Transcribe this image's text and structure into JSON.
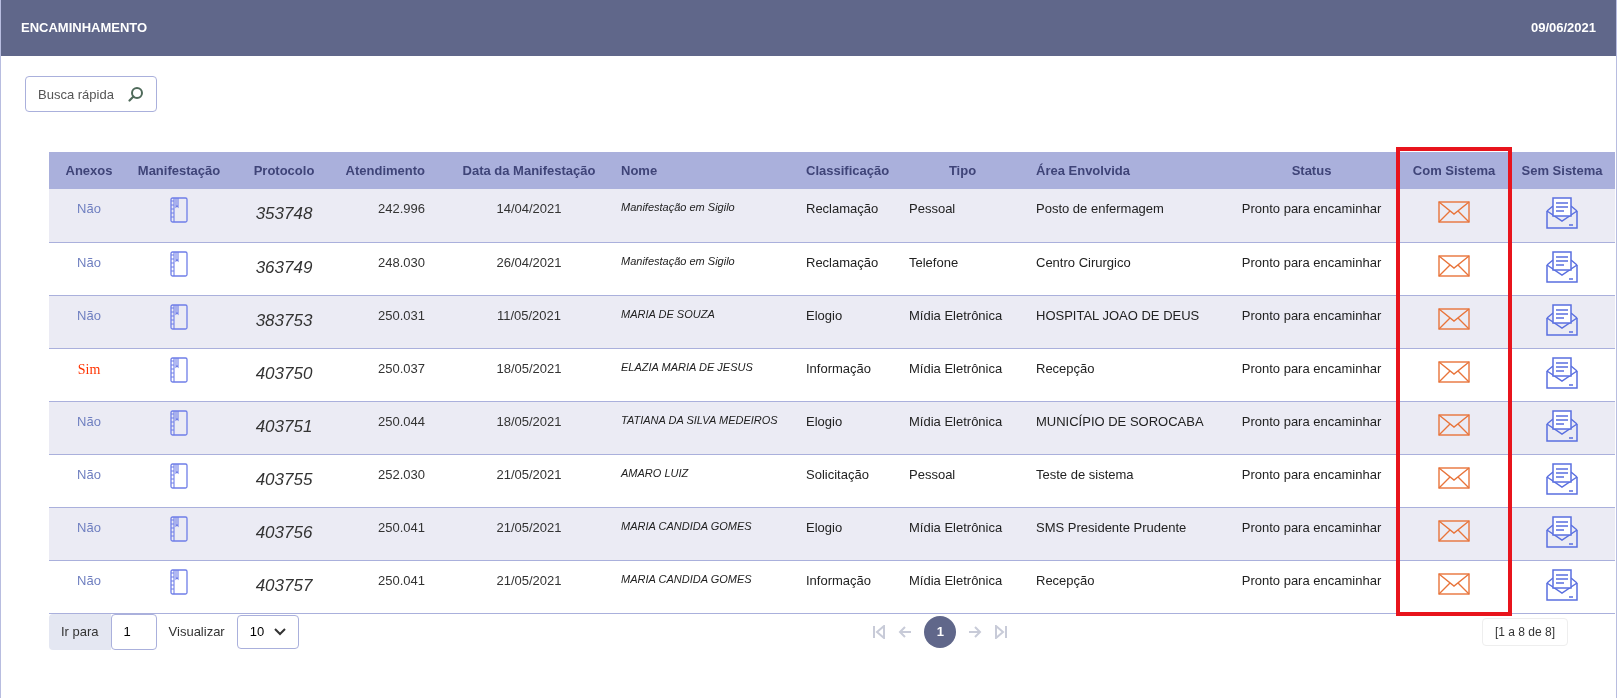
{
  "header": {
    "title": "ENCAMINHAMENTO",
    "date": "09/06/2021"
  },
  "search": {
    "placeholder": "Busca rápida"
  },
  "table": {
    "columns": [
      {
        "label": "Anexos",
        "highlighted": false
      },
      {
        "label": "Manifestação",
        "highlighted": false
      },
      {
        "label": "Protocolo",
        "highlighted": false
      },
      {
        "label": "Atendimento",
        "highlighted": false
      },
      {
        "label": "Data da Manifestação",
        "highlighted": false
      },
      {
        "label": "Nome",
        "highlighted": false
      },
      {
        "label": "Classificação",
        "highlighted": false
      },
      {
        "label": "Tipo",
        "highlighted": false
      },
      {
        "label": "Área Envolvida",
        "highlighted": false
      },
      {
        "label": "Status",
        "highlighted": false
      },
      {
        "label": "Com Sistema",
        "highlighted": true
      },
      {
        "label": "Sem Sistema",
        "highlighted": false
      }
    ],
    "rows": [
      {
        "anexos": "Não",
        "has_attachment": false,
        "protocolo": "353748",
        "atendimento": "242.996",
        "data": "14/04/2021",
        "nome": "Manifestação em Sigilo",
        "classificacao": "Reclamação",
        "tipo": "Pessoal",
        "area": "Posto de enfermagem",
        "status": "Pronto para encaminhar"
      },
      {
        "anexos": "Não",
        "has_attachment": false,
        "protocolo": "363749",
        "atendimento": "248.030",
        "data": "26/04/2021",
        "nome": "Manifestação em Sigilo",
        "classificacao": "Reclamação",
        "tipo": "Telefone",
        "area": "Centro Cirurgico",
        "status": "Pronto para encaminhar"
      },
      {
        "anexos": "Não",
        "has_attachment": false,
        "protocolo": "383753",
        "atendimento": "250.031",
        "data": "11/05/2021",
        "nome": "MARIA DE SOUZA",
        "classificacao": "Elogio",
        "tipo": "Mídia Eletrônica",
        "area": "HOSPITAL JOAO DE DEUS",
        "status": "Pronto para encaminhar"
      },
      {
        "anexos": "Sim",
        "has_attachment": true,
        "protocolo": "403750",
        "atendimento": "250.037",
        "data": "18/05/2021",
        "nome": "ELAZIA MARIA DE JESUS",
        "classificacao": "Informação",
        "tipo": "Mídia Eletrônica",
        "area": "Recepção",
        "status": "Pronto para encaminhar"
      },
      {
        "anexos": "Não",
        "has_attachment": false,
        "protocolo": "403751",
        "atendimento": "250.044",
        "data": "18/05/2021",
        "nome": "TATIANA DA SILVA MEDEIROS",
        "classificacao": "Elogio",
        "tipo": "Mídia Eletrônica",
        "area": "MUNICÍPIO DE SOROCABA",
        "status": "Pronto para encaminhar"
      },
      {
        "anexos": "Não",
        "has_attachment": false,
        "protocolo": "403755",
        "atendimento": "252.030",
        "data": "21/05/2021",
        "nome": "AMARO LUIZ",
        "classificacao": "Solicitação",
        "tipo": "Pessoal",
        "area": "Teste de sistema",
        "status": "Pronto para encaminhar"
      },
      {
        "anexos": "Não",
        "has_attachment": false,
        "protocolo": "403756",
        "atendimento": "250.041",
        "data": "21/05/2021",
        "nome": "MARIA CANDIDA GOMES",
        "classificacao": "Elogio",
        "tipo": "Mídia Eletrônica",
        "area": "SMS Presidente Prudente",
        "status": "Pronto para encaminhar"
      },
      {
        "anexos": "Não",
        "has_attachment": false,
        "protocolo": "403757",
        "atendimento": "250.041",
        "data": "21/05/2021",
        "nome": "MARIA CANDIDA GOMES",
        "classificacao": "Informação",
        "tipo": "Mídia Eletrônica",
        "area": "Recepção",
        "status": "Pronto para encaminhar"
      }
    ]
  },
  "footer": {
    "goto_label": "Ir para",
    "goto_value": "1",
    "view_label": "Visualizar",
    "page_size": "10",
    "pages": [
      {
        "label": "1",
        "selected": true
      }
    ],
    "first_disabled": true,
    "prev_disabled": true,
    "next_disabled": true,
    "last_disabled": true,
    "range": "[1 a 8 de 8]"
  }
}
